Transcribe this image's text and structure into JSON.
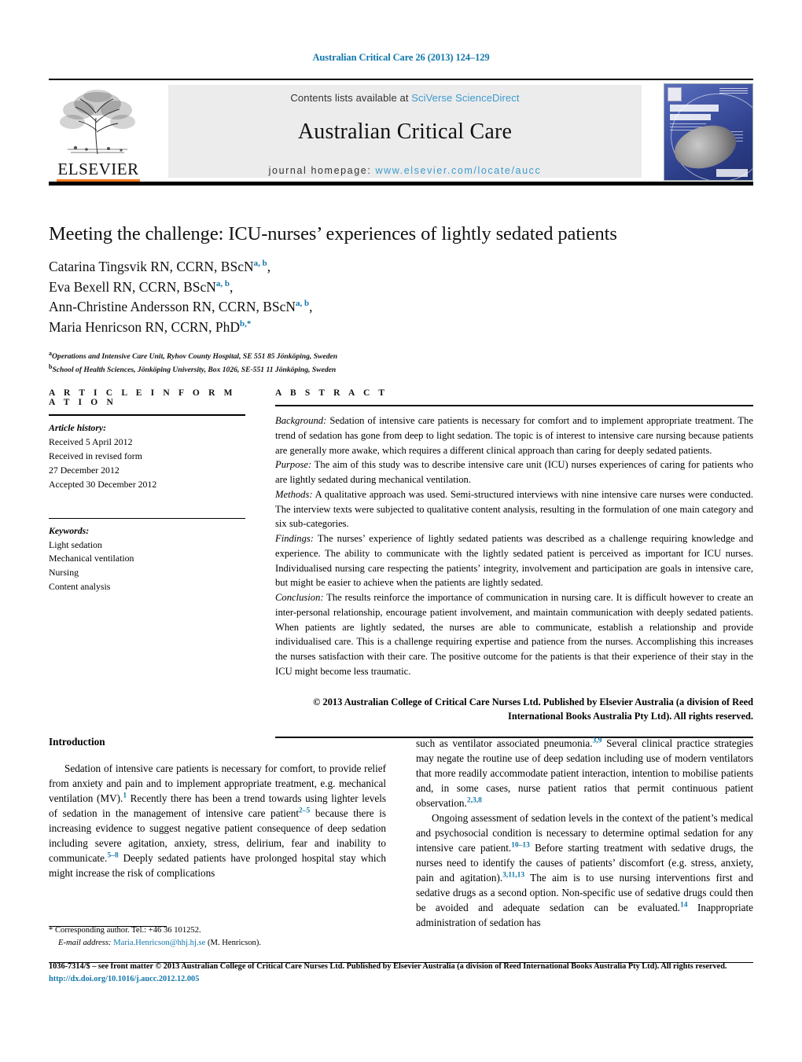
{
  "running_head": "Australian Critical Care 26 (2013) 124–129",
  "masthead": {
    "publisher_name": "ELSEVIER",
    "contents_prefix": "Contents lists available at",
    "contents_link": "SciVerse ScienceDirect",
    "journal_title": "Australian Critical Care",
    "homepage_label": "journal homepage:",
    "homepage_url": "www.elsevier.com/locate/aucc"
  },
  "article": {
    "title": "Meeting the challenge: ICU-nurses’ experiences of lightly sedated patients",
    "authors": [
      {
        "name": "Catarina Tingsvik RN, CCRN, BScN",
        "affil": "a, b",
        "trail": ","
      },
      {
        "name": "Eva Bexell RN, CCRN, BScN",
        "affil": "a, b",
        "trail": ","
      },
      {
        "name": "Ann-Christine Andersson RN, CCRN, BScN",
        "affil": "a, b",
        "trail": ","
      },
      {
        "name": "Maria Henricson RN, CCRN, PhD",
        "affil": "b,*",
        "trail": ""
      }
    ],
    "affiliations": [
      {
        "marker": "a",
        "text": "Operations and Intensive Care Unit, Ryhov County Hospital, SE 551 85 Jönköping, Sweden"
      },
      {
        "marker": "b",
        "text": "School of Health Sciences, Jönköping University, Box 1026, SE-551 11 Jönköping, Sweden"
      }
    ]
  },
  "info": {
    "heading": "A R T I C L E   I N F O R M A T I O N",
    "history_label": "Article history:",
    "history": [
      "Received 5 April 2012",
      "Received in revised form",
      "27 December 2012",
      "Accepted 30 December 2012"
    ],
    "keywords_label": "Keywords:",
    "keywords": [
      "Light sedation",
      "Mechanical ventilation",
      "Nursing",
      "Content analysis"
    ]
  },
  "abstract": {
    "heading": "A B S T R A C T",
    "sections": [
      {
        "label": "Background:",
        "text": " Sedation of intensive care patients is necessary for comfort and to implement appropriate treatment. The trend of sedation has gone from deep to light sedation. The topic is of interest to intensive care nursing because patients are generally more awake, which requires a different clinical approach than caring for deeply sedated patients."
      },
      {
        "label": "Purpose:",
        "text": " The aim of this study was to describe intensive care unit (ICU) nurses experiences of caring for patients who are lightly sedated during mechanical ventilation."
      },
      {
        "label": "Methods:",
        "text": " A qualitative approach was used. Semi-structured interviews with nine intensive care nurses were conducted. The interview texts were subjected to qualitative content analysis, resulting in the formulation of one main category and six sub-categories."
      },
      {
        "label": "Findings:",
        "text": " The nurses’ experience of lightly sedated patients was described as a challenge requiring knowledge and experience. The ability to communicate with the lightly sedated patient is perceived as important for ICU nurses. Individualised nursing care respecting the patients’ integrity, involvement and participation are goals in intensive care, but might be easier to achieve when the patients are lightly sedated."
      },
      {
        "label": "Conclusion:",
        "text": " The results reinforce the importance of communication in nursing care. It is difficult however to create an inter-personal relationship, encourage patient involvement, and maintain communication with deeply sedated patients. When patients are lightly sedated, the nurses are able to communicate, establish a relationship and provide individualised care. This is a challenge requiring expertise and patience from the nurses. Accomplishing this increases the nurses satisfaction with their care. The positive outcome for the patients is that their experience of their stay in the ICU might become less traumatic."
      }
    ],
    "copyright": "© 2013 Australian College of Critical Care Nurses Ltd. Published by Elsevier Australia (a division of Reed International Books Australia Pty Ltd). All rights reserved."
  },
  "body": {
    "intro_heading": "Introduction",
    "left_paragraph_1_a": "Sedation of intensive care patients is necessary for comfort, to provide relief from anxiety and pain and to implement appropriate treatment, e.g. mechanical ventilation (MV).",
    "ref_1": "1",
    "left_paragraph_1_b": " Recently there has been a trend towards using lighter levels of sedation in the management of intensive care patient",
    "ref_2_5": "2–5",
    "left_paragraph_1_c": " because there is increasing evidence to suggest negative patient consequence of deep sedation including severe agitation, anxiety, stress, delirium, fear and inability to communicate.",
    "ref_5_8": "5–8",
    "left_paragraph_1_d": " Deeply sedated patients have prolonged hospital stay which might increase the risk of complications",
    "right_paragraph_1_a": "such as ventilator associated pneumonia.",
    "ref_3_9": "3,9",
    "right_paragraph_1_b": " Several clinical practice strategies may negate the routine use of deep sedation including use of modern ventilators that more readily accommodate patient interaction, intention to mobilise patients and, in some cases, nurse patient ratios that permit continuous patient observation.",
    "ref_2_3_8": "2,3,8",
    "right_paragraph_2_a": "Ongoing assessment of sedation levels in the context of the patient’s medical and psychosocial condition is necessary to determine optimal sedation for any intensive care patient.",
    "ref_10_13": "10–13",
    "right_paragraph_2_b": " Before starting treatment with sedative drugs, the nurses need to identify the causes of patients’ discomfort (e.g. stress, anxiety, pain and agitation).",
    "ref_3_11_13": "3,11,13",
    "right_paragraph_2_c": " The aim is to use nursing interventions first and sedative drugs as a second option. Non-specific use of sedative drugs could then be avoided and adequate sedation can be evaluated.",
    "ref_14": "14",
    "right_paragraph_2_d": " Inappropriate administration of sedation has"
  },
  "footnote": {
    "star": "*",
    "corresponding": "Corresponding author. Tel.: +46 36 101252.",
    "email_label": "E-mail address:",
    "email": "Maria.Henricson@hhj.hj.se",
    "email_suffix": "(M. Henricson)."
  },
  "page_footer": {
    "issn_line": "1036-7314/$ – see front matter © 2013 Australian College of Critical Care Nurses Ltd. Published by Elsevier Australia (a division of Reed International Books Australia Pty Ltd). All rights reserved.",
    "doi": "http://dx.doi.org/10.1016/j.aucc.2012.12.005"
  },
  "colors": {
    "link_blue": "#1277ab",
    "sd_blue": "#3c9bd0",
    "elsevier_orange": "#f47a20",
    "masthead_grey": "#ececec"
  }
}
